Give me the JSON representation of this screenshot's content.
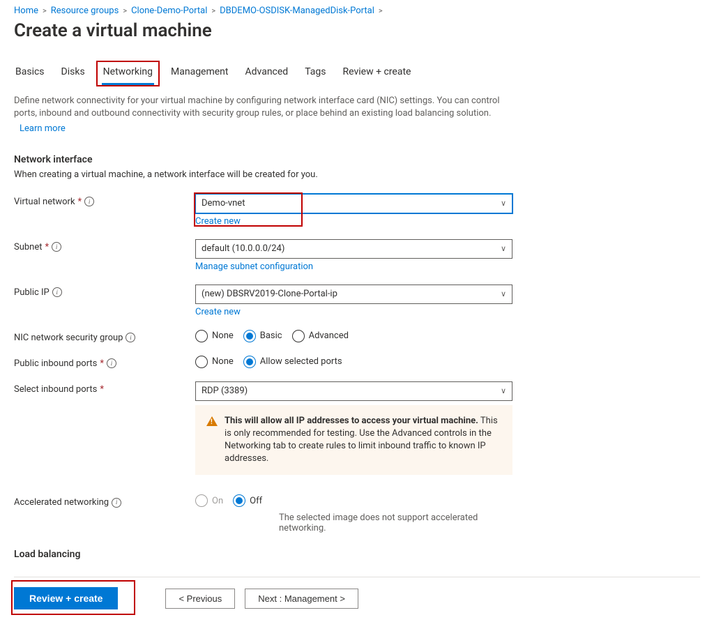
{
  "breadcrumb": {
    "items": [
      "Home",
      "Resource groups",
      "Clone-Demo-Portal",
      "DBDEMO-OSDISK-ManagedDisk-Portal"
    ]
  },
  "page_title": "Create a virtual machine",
  "tabs": {
    "basics": "Basics",
    "disks": "Disks",
    "networking": "Networking",
    "management": "Management",
    "advanced": "Advanced",
    "tags": "Tags",
    "review": "Review + create"
  },
  "intro": {
    "text": "Define network connectivity for your virtual machine by configuring network interface card (NIC) settings. You can control ports, inbound and outbound connectivity with security group rules, or place behind an existing load balancing solution.",
    "learn_more": "Learn more"
  },
  "section": {
    "heading": "Network interface",
    "sub": "When creating a virtual machine, a network interface will be created for you."
  },
  "fields": {
    "vnet": {
      "label": "Virtual network",
      "value": "Demo-vnet",
      "create_new": "Create new"
    },
    "subnet": {
      "label": "Subnet",
      "value": "default (10.0.0.0/24)",
      "manage": "Manage subnet configuration"
    },
    "public_ip": {
      "label": "Public IP",
      "value": "(new) DBSRV2019-Clone-Portal-ip",
      "create_new": "Create new"
    },
    "nsg": {
      "label": "NIC network security group",
      "options": {
        "none": "None",
        "basic": "Basic",
        "advanced": "Advanced"
      }
    },
    "inbound": {
      "label": "Public inbound ports",
      "options": {
        "none": "None",
        "allow": "Allow selected ports"
      }
    },
    "select_ports": {
      "label": "Select inbound ports",
      "value": "RDP (3389)"
    },
    "accel": {
      "label": "Accelerated networking",
      "options": {
        "on": "On",
        "off": "Off"
      },
      "note": "The selected image does not support accelerated networking."
    }
  },
  "warning": {
    "bold": "This will allow all IP addresses to access your virtual machine.",
    "rest": " This is only recommended for testing.  Use the Advanced controls in the Networking tab to create rules to limit inbound traffic to known IP addresses."
  },
  "load_balancing": {
    "heading": "Load balancing"
  },
  "footer": {
    "review": "Review + create",
    "previous": "< Previous",
    "next": "Next : Management >"
  }
}
